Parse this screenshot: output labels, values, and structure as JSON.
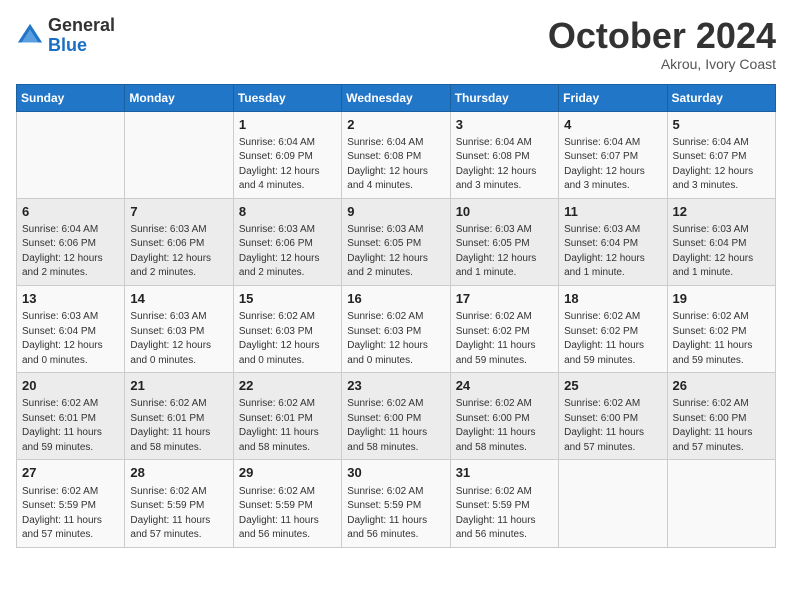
{
  "header": {
    "logo_general": "General",
    "logo_blue": "Blue",
    "month_title": "October 2024",
    "subtitle": "Akrou, Ivory Coast"
  },
  "days_of_week": [
    "Sunday",
    "Monday",
    "Tuesday",
    "Wednesday",
    "Thursday",
    "Friday",
    "Saturday"
  ],
  "weeks": [
    [
      {
        "day": "",
        "info": ""
      },
      {
        "day": "",
        "info": ""
      },
      {
        "day": "1",
        "info": "Sunrise: 6:04 AM\nSunset: 6:09 PM\nDaylight: 12 hours and 4 minutes."
      },
      {
        "day": "2",
        "info": "Sunrise: 6:04 AM\nSunset: 6:08 PM\nDaylight: 12 hours and 4 minutes."
      },
      {
        "day": "3",
        "info": "Sunrise: 6:04 AM\nSunset: 6:08 PM\nDaylight: 12 hours and 3 minutes."
      },
      {
        "day": "4",
        "info": "Sunrise: 6:04 AM\nSunset: 6:07 PM\nDaylight: 12 hours and 3 minutes."
      },
      {
        "day": "5",
        "info": "Sunrise: 6:04 AM\nSunset: 6:07 PM\nDaylight: 12 hours and 3 minutes."
      }
    ],
    [
      {
        "day": "6",
        "info": "Sunrise: 6:04 AM\nSunset: 6:06 PM\nDaylight: 12 hours and 2 minutes."
      },
      {
        "day": "7",
        "info": "Sunrise: 6:03 AM\nSunset: 6:06 PM\nDaylight: 12 hours and 2 minutes."
      },
      {
        "day": "8",
        "info": "Sunrise: 6:03 AM\nSunset: 6:06 PM\nDaylight: 12 hours and 2 minutes."
      },
      {
        "day": "9",
        "info": "Sunrise: 6:03 AM\nSunset: 6:05 PM\nDaylight: 12 hours and 2 minutes."
      },
      {
        "day": "10",
        "info": "Sunrise: 6:03 AM\nSunset: 6:05 PM\nDaylight: 12 hours and 1 minute."
      },
      {
        "day": "11",
        "info": "Sunrise: 6:03 AM\nSunset: 6:04 PM\nDaylight: 12 hours and 1 minute."
      },
      {
        "day": "12",
        "info": "Sunrise: 6:03 AM\nSunset: 6:04 PM\nDaylight: 12 hours and 1 minute."
      }
    ],
    [
      {
        "day": "13",
        "info": "Sunrise: 6:03 AM\nSunset: 6:04 PM\nDaylight: 12 hours and 0 minutes."
      },
      {
        "day": "14",
        "info": "Sunrise: 6:03 AM\nSunset: 6:03 PM\nDaylight: 12 hours and 0 minutes."
      },
      {
        "day": "15",
        "info": "Sunrise: 6:02 AM\nSunset: 6:03 PM\nDaylight: 12 hours and 0 minutes."
      },
      {
        "day": "16",
        "info": "Sunrise: 6:02 AM\nSunset: 6:03 PM\nDaylight: 12 hours and 0 minutes."
      },
      {
        "day": "17",
        "info": "Sunrise: 6:02 AM\nSunset: 6:02 PM\nDaylight: 11 hours and 59 minutes."
      },
      {
        "day": "18",
        "info": "Sunrise: 6:02 AM\nSunset: 6:02 PM\nDaylight: 11 hours and 59 minutes."
      },
      {
        "day": "19",
        "info": "Sunrise: 6:02 AM\nSunset: 6:02 PM\nDaylight: 11 hours and 59 minutes."
      }
    ],
    [
      {
        "day": "20",
        "info": "Sunrise: 6:02 AM\nSunset: 6:01 PM\nDaylight: 11 hours and 59 minutes."
      },
      {
        "day": "21",
        "info": "Sunrise: 6:02 AM\nSunset: 6:01 PM\nDaylight: 11 hours and 58 minutes."
      },
      {
        "day": "22",
        "info": "Sunrise: 6:02 AM\nSunset: 6:01 PM\nDaylight: 11 hours and 58 minutes."
      },
      {
        "day": "23",
        "info": "Sunrise: 6:02 AM\nSunset: 6:00 PM\nDaylight: 11 hours and 58 minutes."
      },
      {
        "day": "24",
        "info": "Sunrise: 6:02 AM\nSunset: 6:00 PM\nDaylight: 11 hours and 58 minutes."
      },
      {
        "day": "25",
        "info": "Sunrise: 6:02 AM\nSunset: 6:00 PM\nDaylight: 11 hours and 57 minutes."
      },
      {
        "day": "26",
        "info": "Sunrise: 6:02 AM\nSunset: 6:00 PM\nDaylight: 11 hours and 57 minutes."
      }
    ],
    [
      {
        "day": "27",
        "info": "Sunrise: 6:02 AM\nSunset: 5:59 PM\nDaylight: 11 hours and 57 minutes."
      },
      {
        "day": "28",
        "info": "Sunrise: 6:02 AM\nSunset: 5:59 PM\nDaylight: 11 hours and 57 minutes."
      },
      {
        "day": "29",
        "info": "Sunrise: 6:02 AM\nSunset: 5:59 PM\nDaylight: 11 hours and 56 minutes."
      },
      {
        "day": "30",
        "info": "Sunrise: 6:02 AM\nSunset: 5:59 PM\nDaylight: 11 hours and 56 minutes."
      },
      {
        "day": "31",
        "info": "Sunrise: 6:02 AM\nSunset: 5:59 PM\nDaylight: 11 hours and 56 minutes."
      },
      {
        "day": "",
        "info": ""
      },
      {
        "day": "",
        "info": ""
      }
    ]
  ]
}
